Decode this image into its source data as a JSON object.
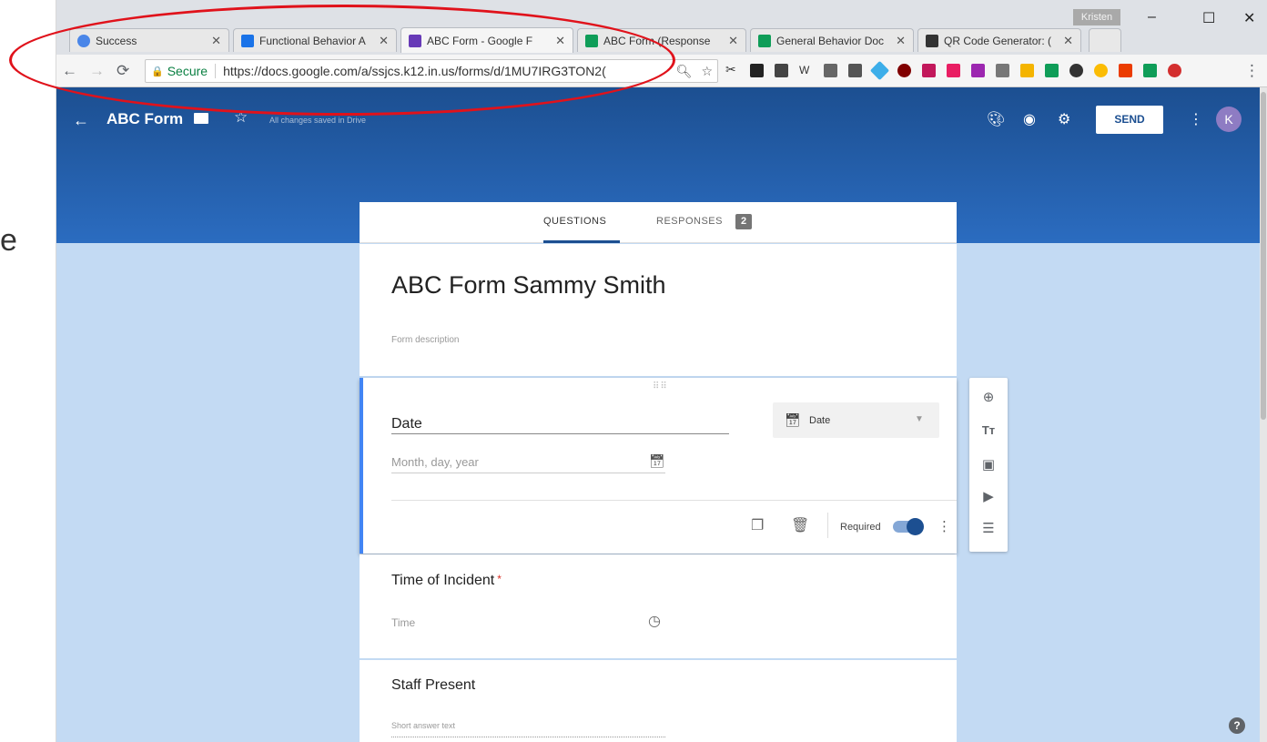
{
  "slide": {
    "fragment": "e"
  },
  "browser": {
    "tabs": [
      {
        "title": "Success",
        "favicon_color": "#4a86e8"
      },
      {
        "title": "Functional Behavior A",
        "favicon_color": "#1a73e8"
      },
      {
        "title": "ABC Form - Google F",
        "favicon_color": "#673ab7"
      },
      {
        "title": "ABC Form (Response",
        "favicon_color": "#0f9d58"
      },
      {
        "title": "General Behavior Doc",
        "favicon_color": "#0f9d58"
      },
      {
        "title": "QR Code Generator: (",
        "favicon_color": "#333333"
      }
    ],
    "active_tab_index": 2,
    "profile_name": "Kristen",
    "window_controls": [
      "–",
      "☐",
      "✕"
    ],
    "address": {
      "secure_label": "Secure",
      "url": "https://docs.google.com/a/ssjcs.k12.in.us/forms/d/1MU7IRG3TON2("
    },
    "extensions_icons": [
      "scissors-icon",
      "new-badge-icon",
      "film-icon",
      "wikipedia-icon",
      "bird-icon",
      "photo-icon",
      "diamond-icon",
      "ublock-icon",
      "shield-icon",
      "cz-icon",
      "puzzle-icon",
      "bulb-icon",
      "coin-icon",
      "image-icon",
      "link-icon",
      "ring-icon",
      "office-icon",
      "stack-icon",
      "palette-icon"
    ]
  },
  "forms": {
    "back_glyph": "←",
    "title": "ABC Form",
    "saved_text": "All changes saved in Drive",
    "send_label": "SEND",
    "avatar_letter": "K",
    "tabs": {
      "questions": "QUESTIONS",
      "responses": "RESPONSES",
      "responses_count": "2"
    },
    "form_title": "ABC Form Sammy Smith",
    "form_description_placeholder": "Form description",
    "questions": [
      {
        "title": "Date",
        "type_label": "Date",
        "input_placeholder": "Month, day, year",
        "required_label": "Required",
        "required": true
      },
      {
        "title": "Time of Incident",
        "required_mark": "*",
        "input_placeholder": "Time"
      },
      {
        "title": "Staff Present",
        "input_placeholder": "Short answer text"
      }
    ],
    "sidebar_tools": [
      "add-question-icon",
      "add-title-icon",
      "add-image-icon",
      "add-video-icon",
      "add-section-icon"
    ],
    "accent_color": "#1c4f91",
    "background_color": "#c3daf3",
    "annotation_color": "#e0121b"
  }
}
